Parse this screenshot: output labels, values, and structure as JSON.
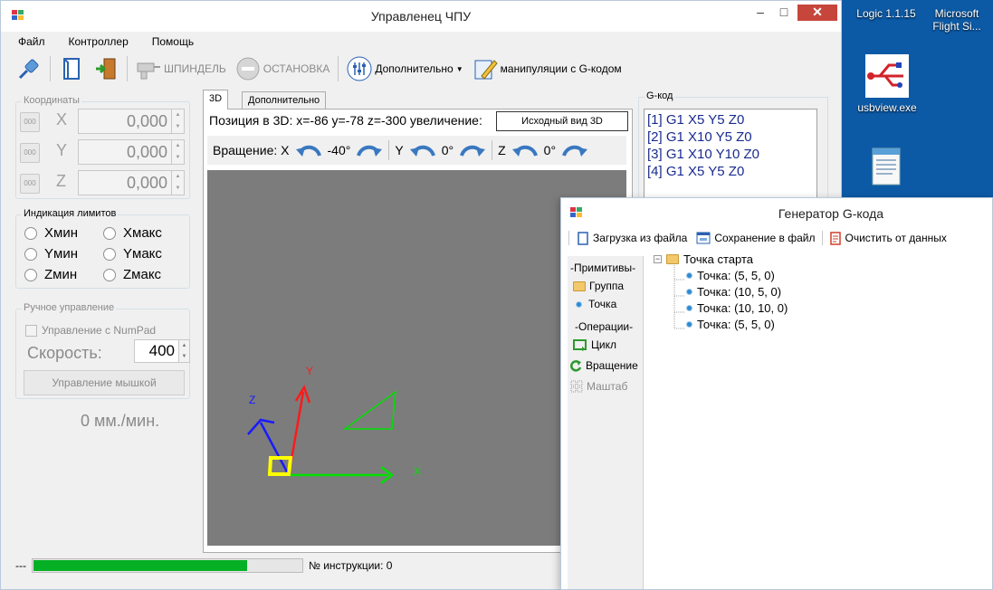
{
  "colors": {
    "progress_green": "#06b025",
    "gcode_blue": "#1a2b8f",
    "viewport_gray": "#7c7c7c"
  },
  "desktop": {
    "icons": [
      {
        "label": "Logic 1.1.15"
      },
      {
        "label": "Microsoft Flight Si..."
      },
      {
        "label": "usbview.exe"
      },
      {
        "label": ""
      }
    ]
  },
  "main_window": {
    "title": "Управленец ЧПУ",
    "menu": [
      "Файл",
      "Контроллер",
      "Помощь"
    ],
    "toolbar": {
      "spindle_label": "ШПИНДЕЛЬ",
      "stop_label": "ОСТАНОВКА",
      "extra_label": "Дополнительно",
      "gcode_manip_label": "манипуляции с G-кодом"
    },
    "coords": {
      "group_label": "Координаты",
      "btn_label": "000",
      "rows": [
        {
          "axis": "X",
          "value": "0,000"
        },
        {
          "axis": "Y",
          "value": "0,000"
        },
        {
          "axis": "Z",
          "value": "0,000"
        }
      ]
    },
    "limits": {
      "group_label": "Индикация лимитов",
      "items": [
        "Xмин",
        "Xмакс",
        "Yмин",
        "Yмакс",
        "Zмин",
        "Zмакс"
      ]
    },
    "manual": {
      "group_label": "Ручное управление",
      "numpad_label": "Управление с NumPad",
      "speed_label": "Скорость:",
      "speed_value": "400",
      "mouse_btn": "Управление мышкой"
    },
    "feed_label": "0 мм./мин.",
    "tabs": [
      "3D",
      "Дополнительно"
    ],
    "view3d": {
      "position_text": "Позиция в 3D: x=-86 y=-78 z=-300 увеличение:",
      "reset_btn": "Исходный вид 3D",
      "rotation_label": "Вращение: X",
      "rot_x": "-40°",
      "axis_y": "Y",
      "rot_y": "0°",
      "axis_z": "Z",
      "rot_z": "0°",
      "axis_labels": {
        "x": "X",
        "y": "Y",
        "z": "Z"
      }
    },
    "gcode": {
      "group_label": "G-код",
      "lines": [
        "[1] G1 X5 Y5 Z0",
        "[2] G1 X10 Y5 Z0",
        "[3] G1 X10 Y10 Z0",
        "[4] G1 X5 Y5 Z0"
      ]
    },
    "status": {
      "prefix": "---",
      "progress": 0.8,
      "instr_label": "№ инструкции: 0"
    }
  },
  "gen_window": {
    "title": "Генератор G-кода",
    "toolbar": [
      "Загрузка из файла",
      "Сохранение в файл",
      "Очистить от данных"
    ],
    "palette": {
      "primitives_hdr": "-Примитивы-",
      "group": "Группа",
      "point": "Точка",
      "operations_hdr": "-Операции-",
      "loop": "Цикл",
      "rotate": "Вращение",
      "scale": "Маштаб"
    },
    "tree": {
      "root": "Точка старта",
      "children": [
        "Точка: (5, 5, 0)",
        "Точка: (10, 5, 0)",
        "Точка: (10, 10, 0)",
        "Точка: (5, 5, 0)"
      ]
    }
  }
}
